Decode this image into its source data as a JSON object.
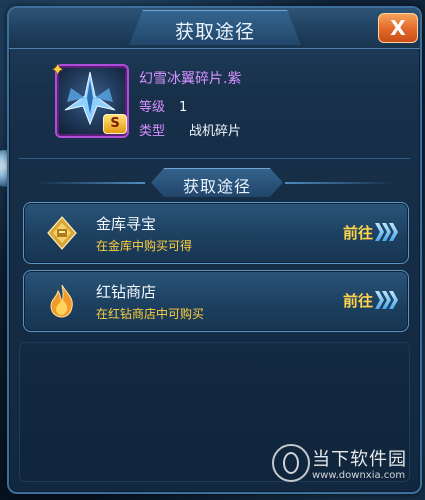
{
  "dialog": {
    "title": "获取途径",
    "close_label": "X"
  },
  "item": {
    "name": "幻雪冰翼碎片.紫",
    "level_label": "等级",
    "level_value": "1",
    "type_label": "类型",
    "type_value": "战机碎片",
    "rank_badge": "S",
    "border_color": "#b14ed9"
  },
  "section": {
    "title": "获取途径"
  },
  "sources": [
    {
      "name": "金库寻宝",
      "description": "在金库中购买可得",
      "action_label": "前往",
      "icon": "treasure-vault-icon"
    },
    {
      "name": "红钻商店",
      "description": "在红钻商店中可购买",
      "action_label": "前往",
      "icon": "flame-icon"
    }
  ],
  "watermark": {
    "brand": "当下软件园",
    "url": "www.downxia.com"
  },
  "colors": {
    "accent_gold": "#ffcf3d",
    "rarity_purple": "#d791ff",
    "close_orange": "#e2672a"
  }
}
